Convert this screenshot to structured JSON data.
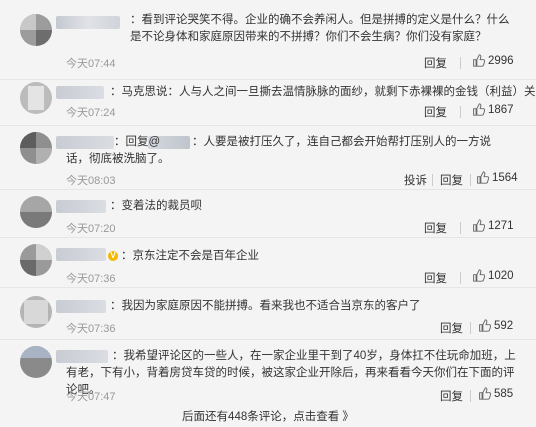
{
  "comments": [
    {
      "text": "：看到评论哭笑不得。企业的确不会养闲人。但是拼搏的定义是什么？什么是不论身体和家庭原因带来的不拼搏？你们不会生病？你们没有家庭？",
      "time": "今天07:44",
      "reply": "回复",
      "likes": "2996"
    },
    {
      "text": "：马克思说：人与人之间一旦撕去温情脉脉的面纱，就剩下赤裸裸的金钱（利益）关系。",
      "time": "今天07:24",
      "reply": "回复",
      "likes": "1867"
    },
    {
      "text_prefix": "：回复@",
      "text": "：人要是被打压久了，连自己都会开始帮打压别人的一方说话，彻底被洗脑了。",
      "time": "今天08:03",
      "report": "投诉",
      "reply": "回复",
      "likes": "1564"
    },
    {
      "text": "：变着法的裁员呗",
      "time": "今天07:20",
      "reply": "回复",
      "likes": "1271"
    },
    {
      "text": "：京东注定不会是百年企业",
      "time": "今天07:36",
      "reply": "回复",
      "likes": "1020"
    },
    {
      "text": "：我因为家庭原因不能拼搏。看来我也不适合当京东的客户了",
      "time": "今天07:36",
      "reply": "回复",
      "likes": "592"
    },
    {
      "text": "：我希望评论区的一些人，在一家企业里干到了40岁，身体扛不住玩命加班，上有老，下有小，背着房贷车贷的时候，被这家企业开除后，再来看看今天你们在下面的评论吧。",
      "time": "今天07:47",
      "reply": "回复",
      "likes": "585"
    }
  ],
  "more_comments": "后面还有448条评论，点击查看 》",
  "colors": {
    "background": "#f4f4f4",
    "text": "#333333",
    "time": "#999999",
    "verified_badge": "#f5b800"
  },
  "icons": {
    "like": "thumbs-up-icon",
    "verified": "verified-badge-icon"
  }
}
